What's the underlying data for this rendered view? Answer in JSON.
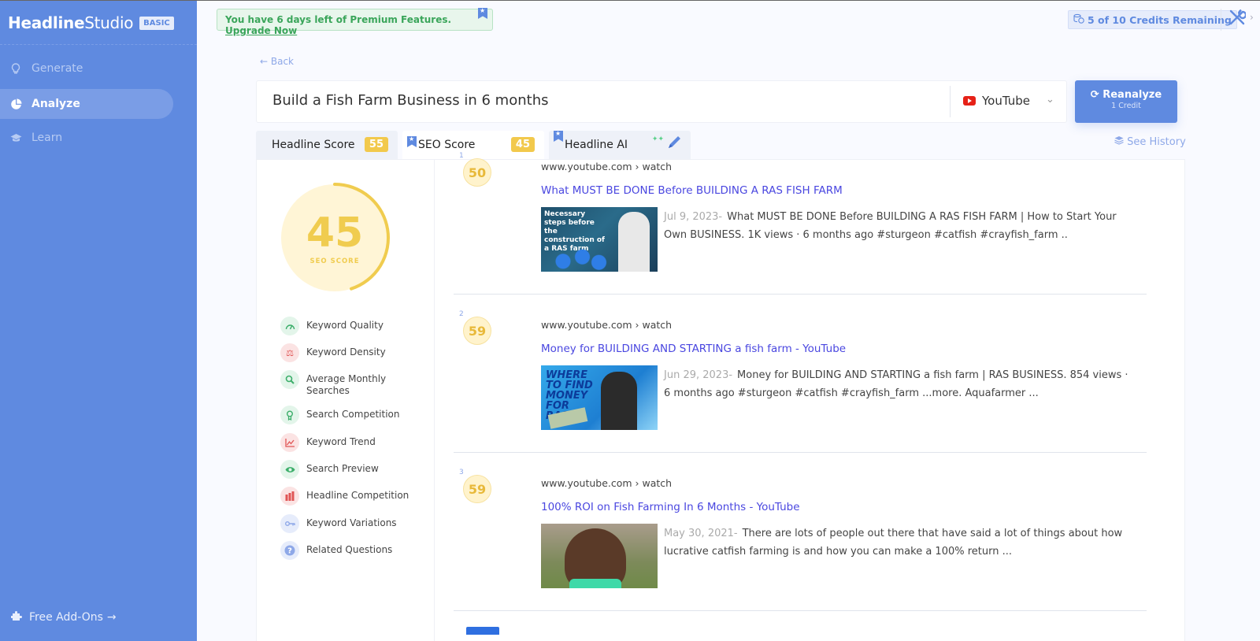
{
  "sidebar": {
    "logo_bold": "Headline",
    "logo_light": "Studio",
    "plan_badge": "BASIC",
    "items": [
      {
        "label": "Generate",
        "icon": "lightbulb-icon"
      },
      {
        "label": "Analyze",
        "icon": "pie-chart-icon",
        "active": true
      },
      {
        "label": "Learn",
        "icon": "graduation-cap-icon"
      }
    ],
    "addons_label": "Free Add-Ons",
    "addons_arrow": "→"
  },
  "topbar": {
    "promo_text": "You have 6 days left of Premium Features.",
    "promo_link": "Upgrade Now",
    "credits_text": "5 of 10 Credits Remaining"
  },
  "back_label": "← Back",
  "search": {
    "value": "Build a Fish Farm Business in 6 months",
    "platform": "YouTube"
  },
  "reanalyze": {
    "label": "Reanalyze",
    "sub": "1 Credit"
  },
  "see_history": "See History",
  "tabs": [
    {
      "label": "Headline Score",
      "score": "55"
    },
    {
      "label": "SEO Score",
      "score": "45",
      "active": true
    },
    {
      "label": "Headline AI"
    }
  ],
  "seo": {
    "score": "45",
    "score_fraction": 0.45,
    "score_label": "SEO SCORE",
    "metrics": [
      {
        "label": "Keyword Quality",
        "icon": "gauge-icon",
        "status": "green"
      },
      {
        "label": "Keyword Density",
        "icon": "scale-icon",
        "status": "red"
      },
      {
        "label": "Average Monthly Searches",
        "icon": "search-icon",
        "status": "green"
      },
      {
        "label": "Search Competition",
        "icon": "award-icon",
        "status": "green"
      },
      {
        "label": "Keyword Trend",
        "icon": "trend-chart-icon",
        "status": "red"
      },
      {
        "label": "Search Preview",
        "icon": "eye-icon",
        "status": "green"
      },
      {
        "label": "Headline Competition",
        "icon": "bar-chart-icon",
        "status": "red"
      },
      {
        "label": "Keyword Variations",
        "icon": "key-icon",
        "status": "blue"
      },
      {
        "label": "Related Questions",
        "icon": "question-icon",
        "status": "blue"
      }
    ]
  },
  "results": [
    {
      "rank": "1",
      "score": "50",
      "url": "www.youtube.com › watch",
      "title": "What MUST BE DONE Before BUILDING A RAS FISH FARM",
      "date": "Jul 9, 2023-",
      "description": "What MUST BE DONE Before BUILDING A RAS FISH FARM | How to Start Your Own BUSINESS. 1K views · 6 months ago #sturgeon #catfish #crayfish_farm ..",
      "thumb_caption": "Necessary steps before the construction of a RAS farm"
    },
    {
      "rank": "2",
      "score": "59",
      "url": "www.youtube.com › watch",
      "title": "Money for BUILDING AND STARTING a fish farm - YouTube",
      "date": "Jun 29, 2023-",
      "description": "Money for BUILDING AND STARTING a fish farm | RAS BUSINESS. 854 views · 6 months ago #sturgeon #catfish #crayfish_farm ...more. Aquafarmer ...",
      "thumb_caption": "WHERE TO FIND MONEY FOR RAS"
    },
    {
      "rank": "3",
      "score": "59",
      "url": "www.youtube.com › watch",
      "title": "100% ROI on Fish Farming In 6 Months - YouTube",
      "date": "May 30, 2021-",
      "description": "There are lots of people out there that have said a lot of things about how lucrative catfish farming is and how you can make a 100% return ...",
      "thumb_caption": ""
    }
  ]
}
